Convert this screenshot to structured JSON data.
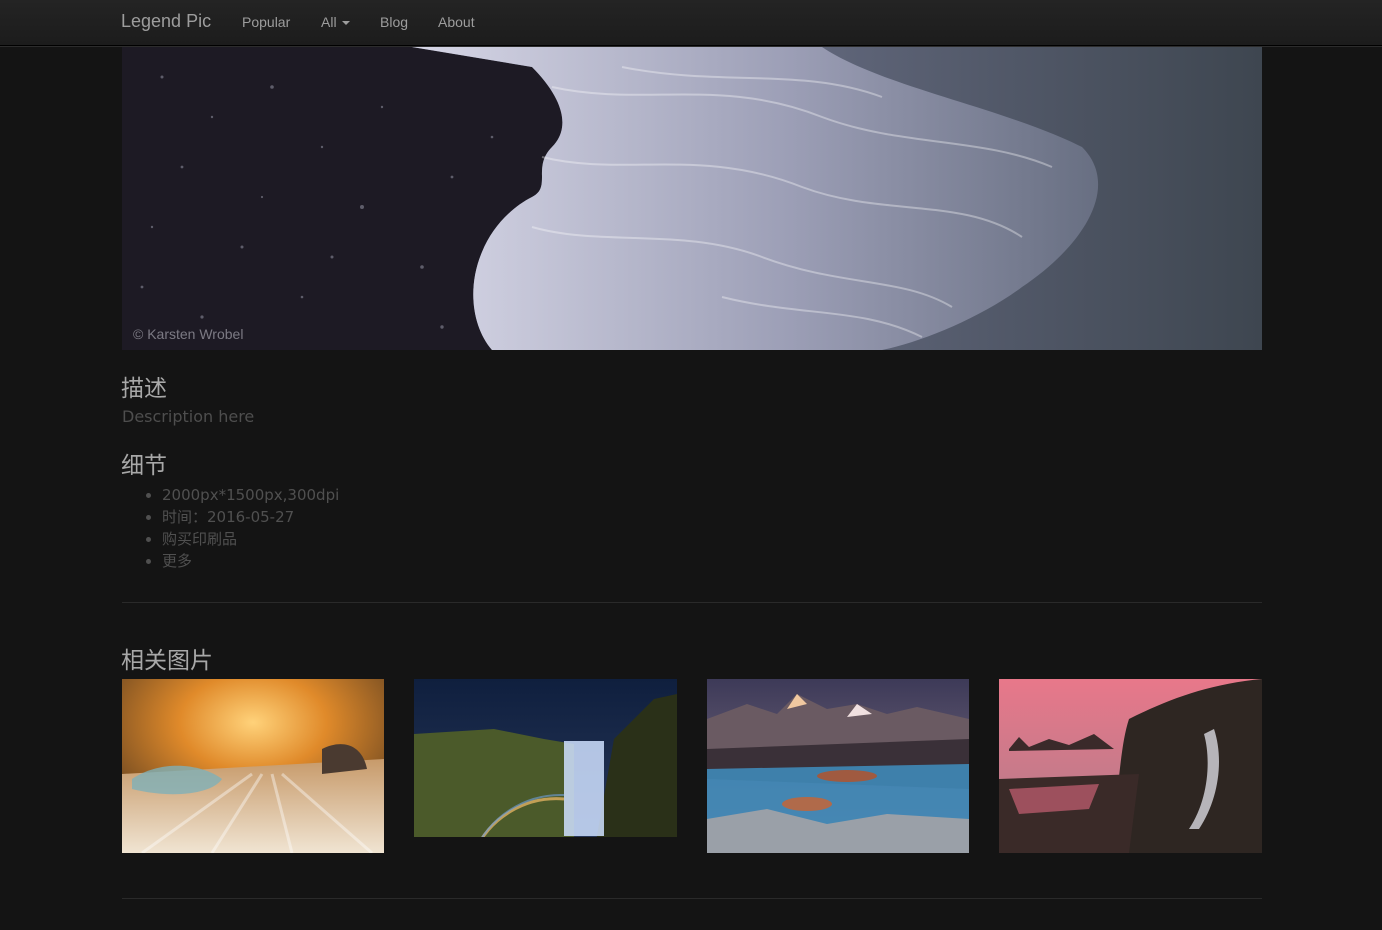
{
  "navbar": {
    "brand": "Legend Pic",
    "items": [
      {
        "label": "Popular"
      },
      {
        "label": "All",
        "has_caret": true
      },
      {
        "label": "Blog"
      },
      {
        "label": "About"
      }
    ]
  },
  "hero": {
    "credit": "© Karsten Wrobel"
  },
  "description": {
    "heading": "描述",
    "text": "Description here"
  },
  "details": {
    "heading": "细节",
    "items": [
      "2000px*1500px,300dpi",
      "时间：2016-05-27",
      "购买印刷品",
      "更多"
    ]
  },
  "related": {
    "heading": "相关图片",
    "thumbnails": [
      {
        "scene": "golden-sunrise-ice-beach"
      },
      {
        "scene": "night-waterfall-rainbow"
      },
      {
        "scene": "mountain-river-rocks"
      },
      {
        "scene": "pink-sky-coastal-waterfall"
      }
    ]
  }
}
